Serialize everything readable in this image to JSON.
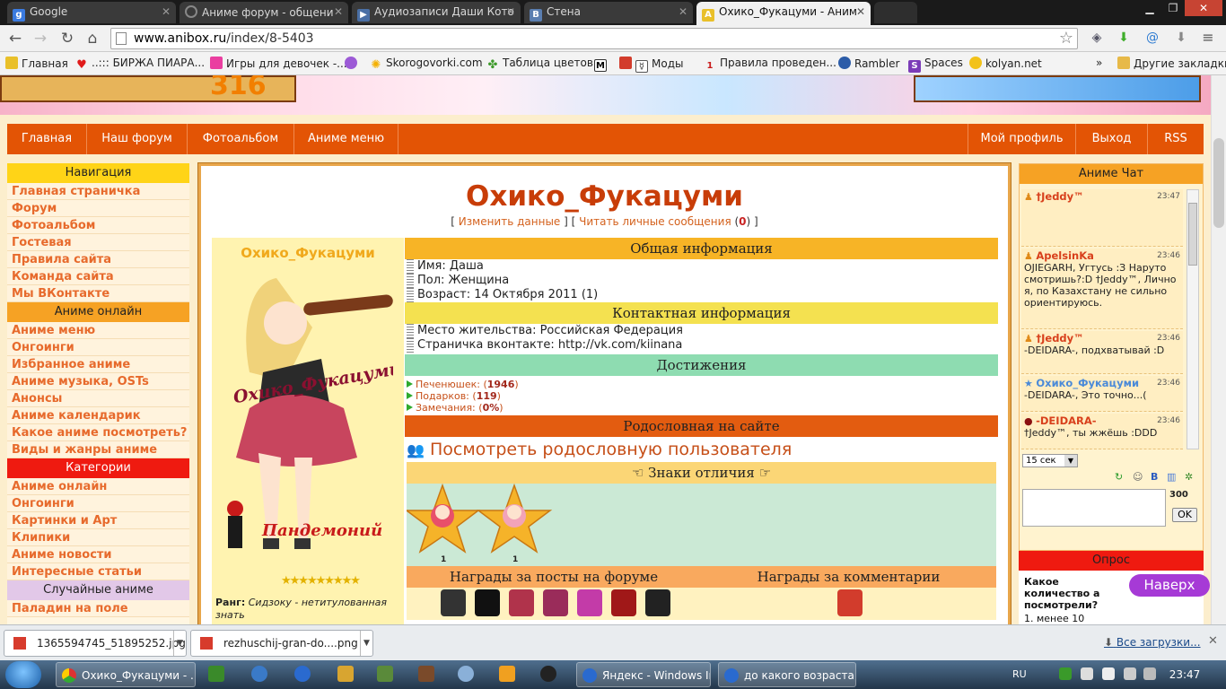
{
  "browser": {
    "tabs": [
      {
        "label": "Google",
        "icon": "google-icon"
      },
      {
        "label": "Аниме форум - общени",
        "icon": "loading-icon"
      },
      {
        "label": "Аудиозаписи Даши Кото",
        "icon": "play-icon"
      },
      {
        "label": "Стена",
        "icon": "vk-icon"
      },
      {
        "label": "Охико_Фукацуми - Аним",
        "icon": "anibox-icon"
      }
    ],
    "url_host": "www.anibox.ru",
    "url_path": "/index/8-5403",
    "bookmarks": [
      "Главная",
      "..::: БИРЖА ПИАРА...",
      "Игры для девочек -...",
      "Skorogovorki.com",
      "Таблица цветов",
      "Моды",
      "Правила проведен...",
      "Rambler",
      "Spaces",
      "kolyan.net"
    ],
    "other_bookmarks": "Другие закладки",
    "more_bookmarks": "»"
  },
  "page": {
    "banner_number": "316",
    "nav_left": [
      "Главная",
      "Наш форум",
      "Фотоальбом",
      "Аниме меню"
    ],
    "nav_right": [
      "Мой профиль",
      "Выход",
      "RSS"
    ],
    "sidebar": {
      "navigation_title": "Навигация",
      "navigation": [
        "Главная страничка",
        "Форум",
        "Фотоальбом",
        "Гостевая",
        "Правила сайта",
        "Команда сайта",
        "Мы ВКонтакте"
      ],
      "anime_online_title": "Аниме онлайн",
      "anime_online": [
        "Аниме меню",
        "Онгоинги",
        "Избранное аниме",
        "Аниме музыка, OSTs",
        "Анонсы",
        "Аниме календарик",
        "Какое аниме посмотреть?",
        "Виды и жанры аниме"
      ],
      "categories_title": "Категории",
      "categories": [
        "Аниме онлайн",
        "Онгоинги",
        "Картинки и Арт",
        "Клипики",
        "Аниме новости",
        "Интересные статьи"
      ],
      "random_title": "Случайные аниме",
      "random": [
        "Паладин на поле"
      ]
    },
    "profile": {
      "title": "Охико_Фукацуми",
      "edit_link": "Изменить данные",
      "messages_link": "Читать личные сообщения",
      "messages_count": "0",
      "avatar_name": "Охико_Фукацуми",
      "avatar_caption": "Охико_Фукацуми",
      "clan_caption": "Пандемоний",
      "rank_label": "Ранг:",
      "rank_value": "Сидзоку - нетитулованная знать",
      "general_title": "Общая информация",
      "general": [
        "Имя: Даша",
        "Пол: Женщина",
        "Возраст: 14 Октября 2011 (1)"
      ],
      "contact_title": "Контактная информация",
      "contact": [
        "Место жительства: Российская Федерация",
        "Страничка вконтакте: http://vk.com/kiinana"
      ],
      "achievements_title": "Достижения",
      "achievements": [
        {
          "label": "Печенюшек:",
          "value": "1946"
        },
        {
          "label": "Подарков:",
          "value": "119"
        },
        {
          "label": "Замечания:",
          "value": "0%"
        }
      ],
      "lineage_title": "Родословная на сайте",
      "lineage_link": "Посмотреть родословную пользователя",
      "badges_title": "☜ Знаки отличия ☞",
      "badge_counts": [
        "1",
        "1"
      ],
      "forum_awards_title": "Награды за посты на форуме",
      "comment_awards_title": "Награды за комментарии"
    },
    "chat": {
      "title": "Аниме Чат",
      "messages": [
        {
          "name": "†Jeddy™",
          "time": "23:47",
          "text": ""
        },
        {
          "name": "ApelsinKa",
          "time": "23:46",
          "text": "OJIEGARH, Угтусь :З Наруто смотришь?:D †Jeddy™, Лично я, по Казахстану не сильно ориентируюсь."
        },
        {
          "name": "†Jeddy™",
          "time": "23:46",
          "text": "-DEIDARA-, подхватывай :D"
        },
        {
          "name": "Охико_Фукацуми",
          "time": "23:46",
          "text": "-DEIDARA-, Это точно...("
        },
        {
          "name": "-DEIDARA-",
          "time": "23:46",
          "text": "†Jeddy™, ты жжёшь :DDD"
        }
      ],
      "refresh": "15 сек",
      "char_count": "300",
      "ok": "OK"
    },
    "poll": {
      "title": "Опрос",
      "question": "Какое количество а посмотрели?",
      "option1": "1. менее 10"
    },
    "to_top": "Наверх"
  },
  "downloads": {
    "items": [
      "1365594745_51895252.jpg",
      "rezhuschij-gran-do....png"
    ],
    "all": "Все загрузки..."
  },
  "taskbar": {
    "tasks": [
      "Охико_Фукацуми - ...",
      "Яндекс - Windows In...",
      "до какого возраста ..."
    ],
    "lang": "RU",
    "time": "23:47"
  },
  "colors": {
    "nav": "#e35405",
    "title": "#c83d08",
    "sidebar_link": "#e76a2c"
  }
}
